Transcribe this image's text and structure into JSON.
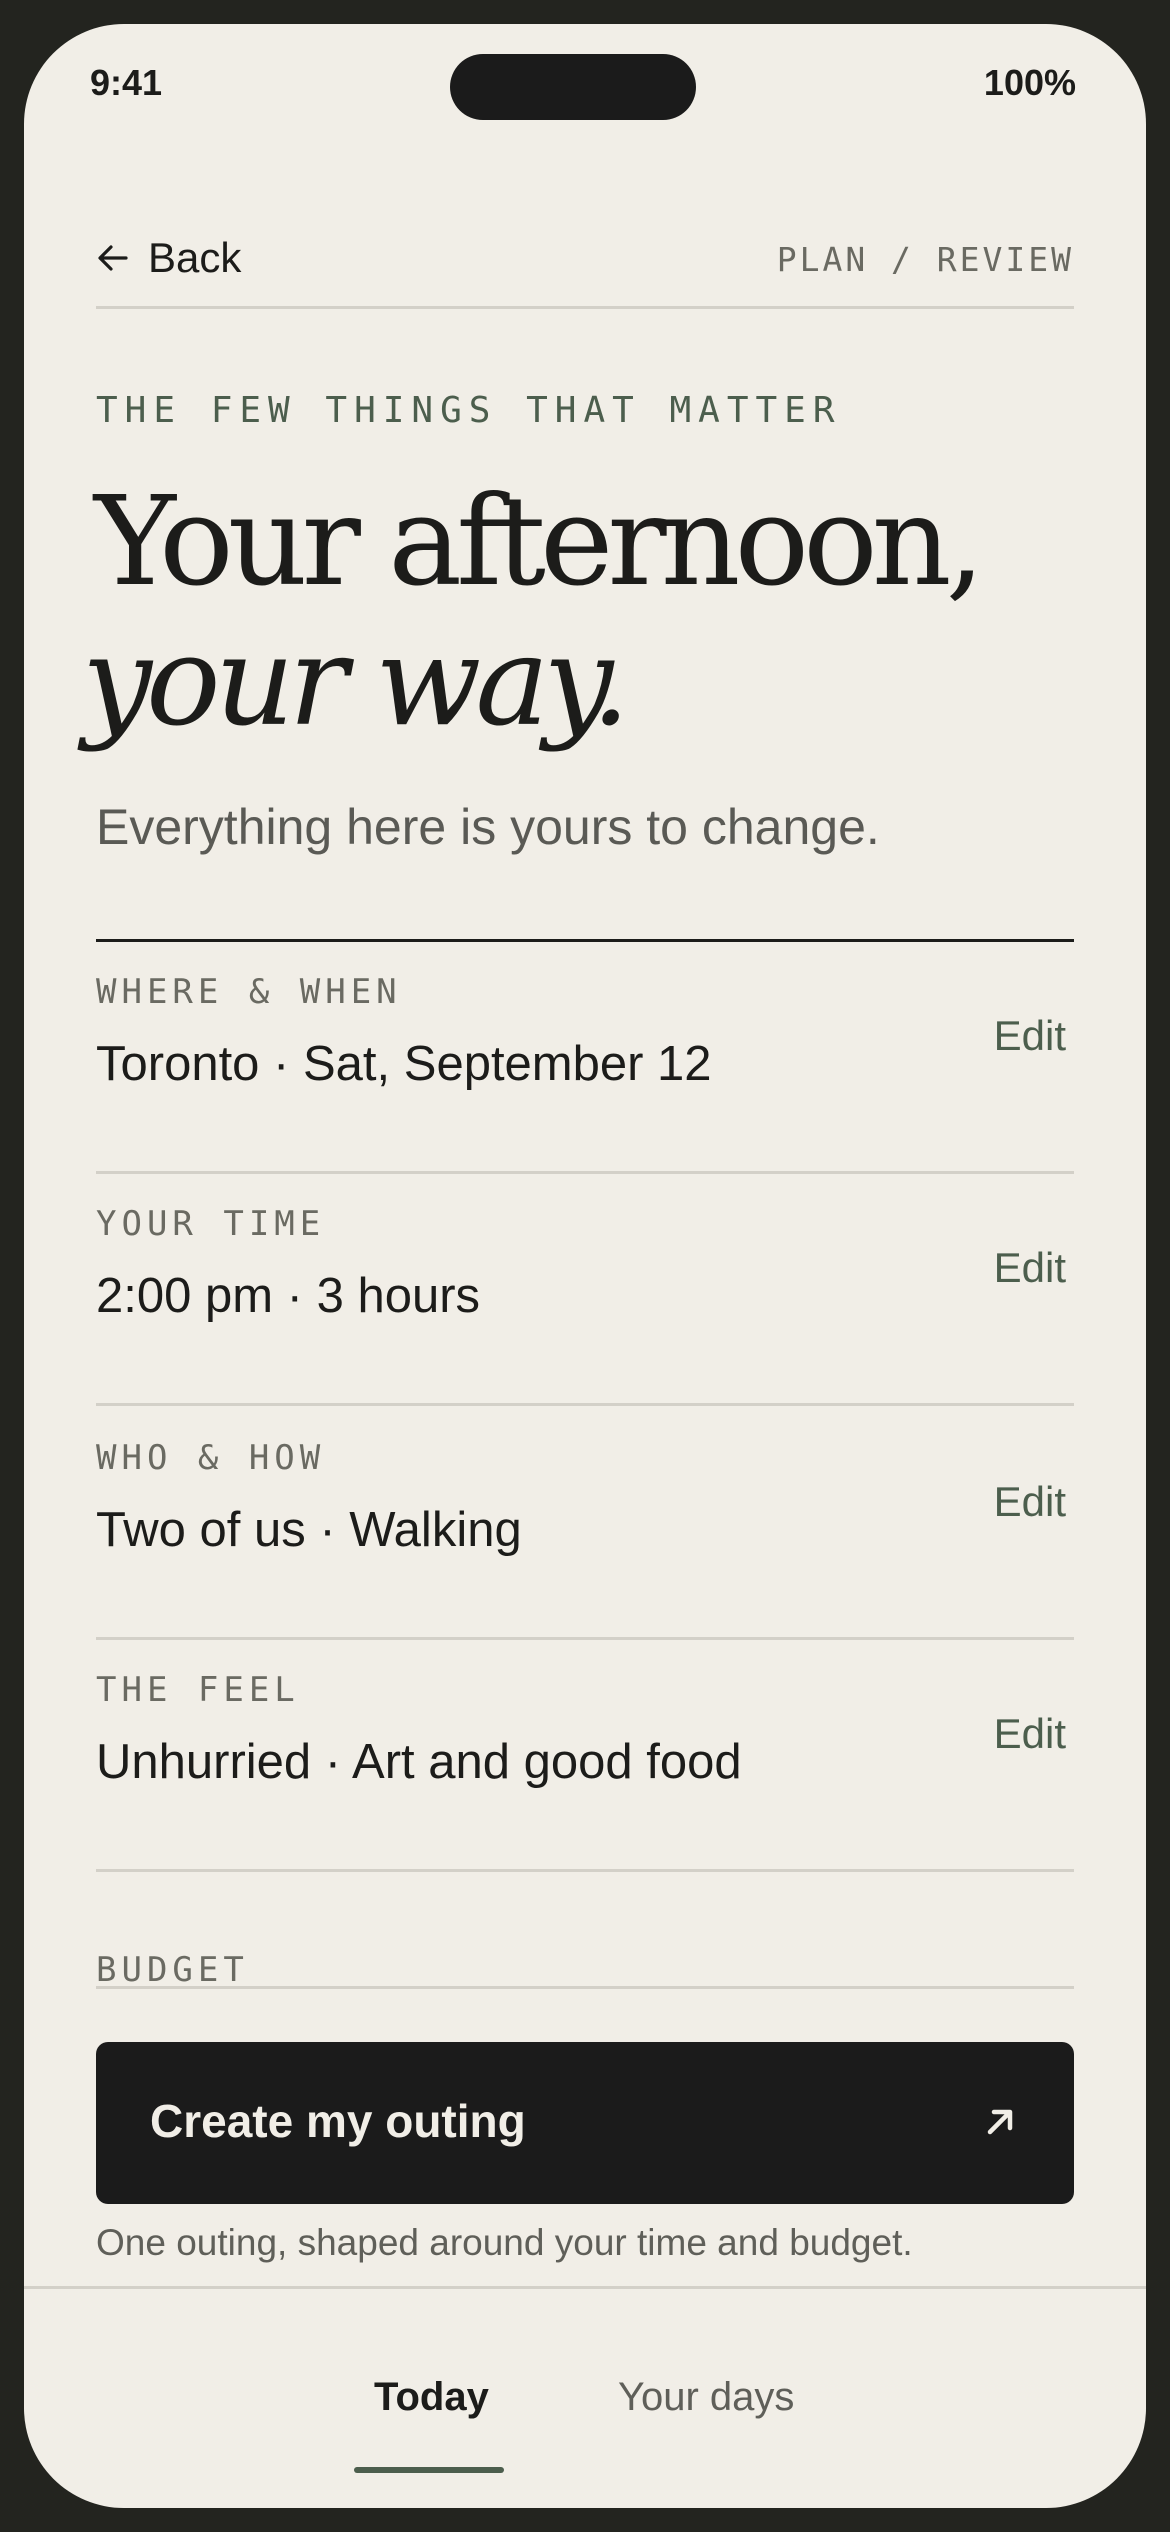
{
  "status": {
    "time": "9:41",
    "battery": "100%"
  },
  "nav": {
    "back_label": "Back",
    "breadcrumb": "PLAN / REVIEW"
  },
  "hero": {
    "eyebrow": "THE FEW THINGS THAT MATTER",
    "title_line1": "Your afternoon,",
    "title_line2": "your way.",
    "subtitle": "Everything here is yours to change."
  },
  "rows": [
    {
      "label": "WHERE & WHEN",
      "value": "Toronto · Sat, September 12",
      "edit": "Edit"
    },
    {
      "label": "YOUR TIME",
      "value": "2:00 pm · 3 hours",
      "edit": "Edit"
    },
    {
      "label": "WHO & HOW",
      "value": "Two of us · Walking",
      "edit": "Edit"
    },
    {
      "label": "THE FEEL",
      "value": "Unhurried · Art and good food",
      "edit": "Edit"
    }
  ],
  "budget_label": "BUDGET",
  "cta": {
    "label": "Create my outing",
    "caption": "One outing, shaped around your time and budget."
  },
  "tabs": [
    {
      "label": "Today",
      "active": true
    },
    {
      "label": "Your days",
      "active": false
    }
  ],
  "colors": {
    "background": "#f1eee7",
    "ink": "#1c1c1a",
    "accent_green": "#4c5e4d",
    "cta_bg": "#1b1b1b"
  },
  "icons": {
    "back": "arrow-left-icon",
    "cta": "arrow-up-right-icon"
  }
}
